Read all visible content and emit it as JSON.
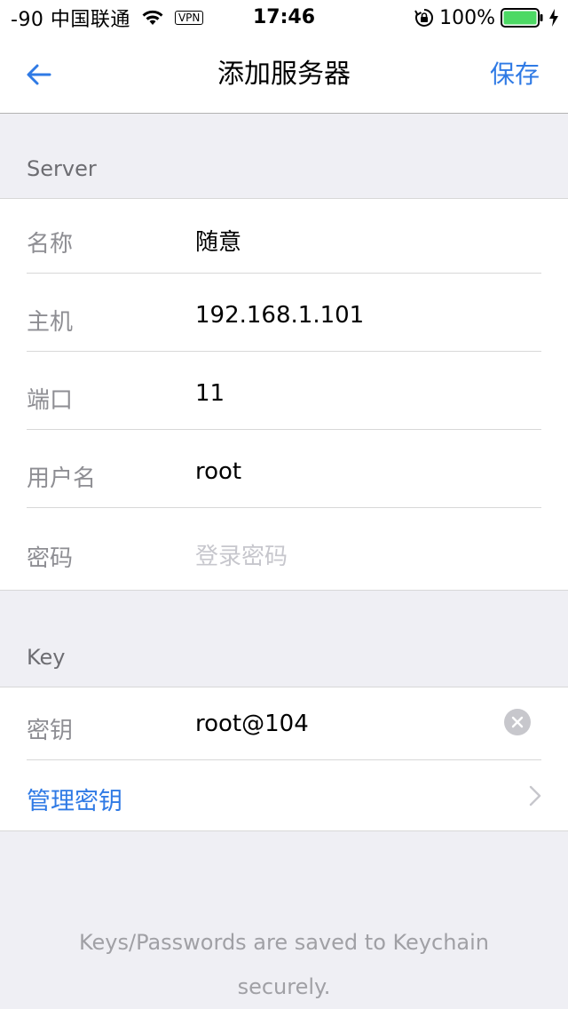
{
  "status_bar": {
    "carrier": "-90 中国联通",
    "vpn": "VPN",
    "time": "17:46",
    "battery_pct": "100%",
    "battery_level": 1.0,
    "accent": "#4cd964"
  },
  "nav": {
    "title": "添加服务器",
    "save_label": "保存",
    "back_icon": "arrow-left-icon",
    "accent": "#2f7ae5"
  },
  "server_section": {
    "header": "Server",
    "rows": [
      {
        "label": "名称",
        "value": "随意"
      },
      {
        "label": "主机",
        "value": "192.168.1.101"
      },
      {
        "label": "端口",
        "value": "11"
      },
      {
        "label": "用户名",
        "value": "root"
      },
      {
        "label": "密码",
        "value": "",
        "placeholder": "登录密码"
      }
    ]
  },
  "key_section": {
    "header": "Key",
    "key_row": {
      "label": "密钥",
      "value": "root@104"
    },
    "manage_label": "管理密钥"
  },
  "footer": {
    "note": "Keys/Passwords are saved to Keychain securely."
  }
}
